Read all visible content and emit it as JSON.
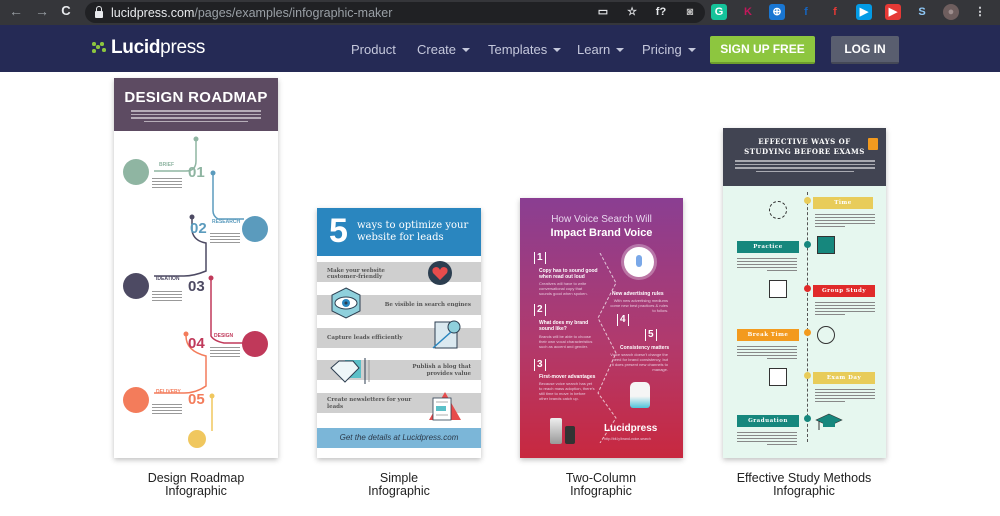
{
  "browser": {
    "url_host": "lucidpress.com",
    "url_path": "/pages/examples/infographic-maker",
    "back_icon": "←",
    "forward_icon": "→",
    "reload_icon": "C",
    "extensions": [
      {
        "name": "cast-icon",
        "glyph": "▭",
        "color": "#e8eaed",
        "bg": "transparent"
      },
      {
        "name": "bookmark-star-icon",
        "glyph": "☆",
        "color": "#e8eaed",
        "bg": "transparent"
      },
      {
        "name": "formula-extension-icon",
        "glyph": "f?",
        "color": "#e8eaed",
        "bg": "transparent"
      },
      {
        "name": "camera-extension-icon",
        "glyph": "◙",
        "color": "#bbbbbb",
        "bg": "transparent"
      },
      {
        "name": "grammarly-extension-icon",
        "glyph": "G",
        "color": "#fff",
        "bg": "#15c39a"
      },
      {
        "name": "k-extension-icon",
        "glyph": "K",
        "color": "#c2185b",
        "bg": "transparent"
      },
      {
        "name": "web-extension-icon",
        "glyph": "⊕",
        "color": "#fff",
        "bg": "#1976d2"
      },
      {
        "name": "facebook-extension-icon",
        "glyph": "f",
        "color": "#1565c0",
        "bg": "transparent"
      },
      {
        "name": "flipboard-extension-icon",
        "glyph": "f",
        "color": "#e53935",
        "bg": "transparent"
      },
      {
        "name": "share-extension-icon",
        "glyph": "▶",
        "color": "#fff",
        "bg": "#039be5"
      },
      {
        "name": "youtube-extension-icon",
        "glyph": "▶",
        "color": "#fff",
        "bg": "#e53935"
      },
      {
        "name": "s-extension-icon",
        "glyph": "S",
        "color": "#90caf9",
        "bg": "transparent"
      },
      {
        "name": "profile-avatar-icon",
        "glyph": "●",
        "color": "#9e8e8e",
        "bg": "transparent"
      },
      {
        "name": "menu-kebab-icon",
        "glyph": "⋮",
        "color": "#e8eaed",
        "bg": "transparent"
      }
    ]
  },
  "header": {
    "logo_bold": "Lucid",
    "logo_light": "press",
    "nav": [
      {
        "label": "Product",
        "dropdown": false
      },
      {
        "label": "Create",
        "dropdown": true
      },
      {
        "label": "Templates",
        "dropdown": true
      },
      {
        "label": "Learn",
        "dropdown": true
      },
      {
        "label": "Pricing",
        "dropdown": true
      }
    ],
    "signup_label": "SIGN UP FREE",
    "login_label": "LOG IN",
    "colors": {
      "bg": "#252a55",
      "signup": "#8dc63f",
      "login": "#595e6f"
    }
  },
  "cards": [
    {
      "caption_line1": "Design Roadmap",
      "caption_line2": "Infographic",
      "title": "DESIGN ROADMAP",
      "steps": [
        {
          "num": "01",
          "label": "BRIEF",
          "color": "#8fb5a2"
        },
        {
          "num": "02",
          "label": "RESEARCH",
          "color": "#5b9bbd"
        },
        {
          "num": "03",
          "label": "IDEATION",
          "color": "#4d4a63"
        },
        {
          "num": "04",
          "label": "DESIGN",
          "color": "#c0395a"
        },
        {
          "num": "05",
          "label": "DELIVERY",
          "color": "#f37c5b"
        }
      ]
    },
    {
      "caption_line1": "Simple",
      "caption_line2": "Infographic",
      "big_number": "5",
      "title": "ways to optimize your website for leads",
      "items": [
        "Make your website customer-friendly",
        "Be visible in search engines",
        "Capture leads efficiently",
        "Publish a blog that provides value",
        "Create newsletters for your leads"
      ],
      "footer": "Get the details at Lucidpress.com"
    },
    {
      "caption_line1": "Two-Column",
      "caption_line2": "Infographic",
      "title_line1": "How Voice Search Will",
      "title_line2": "Impact Brand Voice",
      "points": [
        {
          "num": "1",
          "heading": "Copy has to sound good when read out loud",
          "text": "Creatives will have to write conversational copy that sounds good when spoken."
        },
        {
          "num": "2",
          "heading": "What does my brand sound like?",
          "text": "Brands will be able to choose their own vocal characteristics such as accent and gender."
        },
        {
          "num": "3",
          "heading": "First-mover advantages",
          "text": "Because voice search has yet to reach mass adoption, there's still time to move in before other brands catch up."
        },
        {
          "num": "4",
          "heading": "New advertising rules",
          "text": "With new advertising mediums come new best practices & rules to follow."
        },
        {
          "num": "5",
          "heading": "Consistency matters",
          "text": "Voice search doesn't change the need for brand consistency, but it does present new channels to manage."
        }
      ],
      "brand": "Lucidpress",
      "link": "http://bit.ly/brand-voice-search"
    },
    {
      "caption_line1": "Effective Study Methods",
      "caption_line2": "Infographic",
      "title_line1": "EFFECTIVE WAYS OF",
      "title_line2": "STUDYING BEFORE EXAMS",
      "tags": [
        {
          "label": "Time",
          "color": "#e8cc5a"
        },
        {
          "label": "Practice",
          "color": "#16877d"
        },
        {
          "label": "Group Study",
          "color": "#e02a2a"
        },
        {
          "label": "Break Time",
          "color": "#f39a1e"
        },
        {
          "label": "Exam Day",
          "color": "#e8cc5a"
        },
        {
          "label": "Graduation",
          "color": "#16877d"
        }
      ]
    }
  ]
}
